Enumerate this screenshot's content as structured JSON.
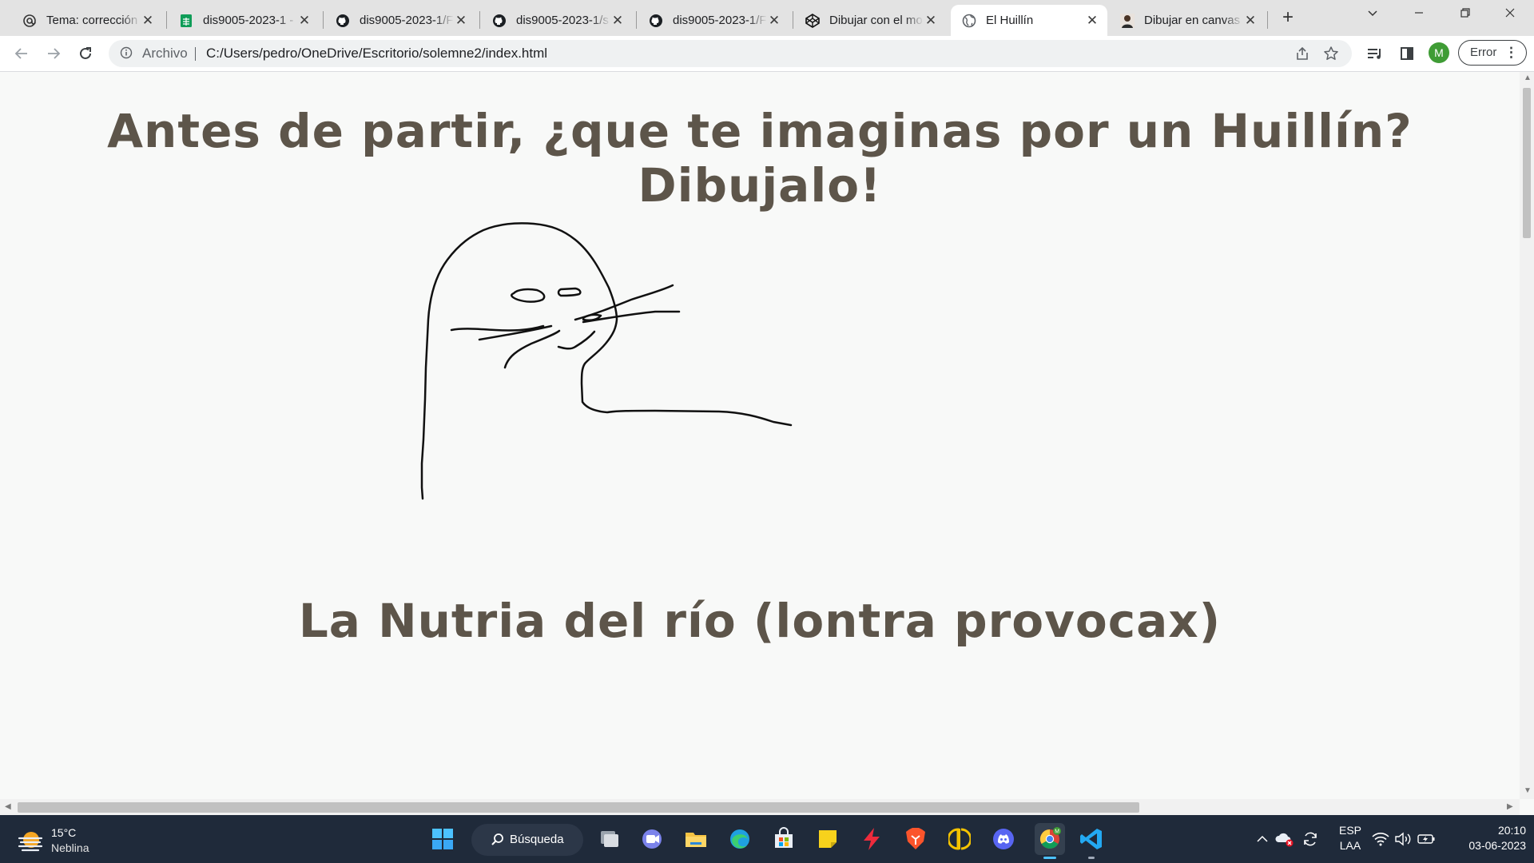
{
  "browser": {
    "tabs": [
      {
        "title": "Tema: corrección",
        "icon": "at-sign-icon"
      },
      {
        "title": "dis9005-2023-1 -",
        "icon": "sheets-icon"
      },
      {
        "title": "dis9005-2023-1/F",
        "icon": "github-icon"
      },
      {
        "title": "dis9005-2023-1/s",
        "icon": "github-icon"
      },
      {
        "title": "dis9005-2023-1/F",
        "icon": "github-icon"
      },
      {
        "title": "Dibujar con el mo",
        "icon": "codepen-icon"
      },
      {
        "title": "El Huillín",
        "icon": "globe-icon",
        "active": true
      },
      {
        "title": "Dibujar en canvas",
        "icon": "avatar-icon"
      }
    ],
    "address_bar": {
      "scheme_label": "Archivo",
      "url": "C:/Users/pedro/OneDrive/Escritorio/solemne2/index.html"
    },
    "profile_initial": "M",
    "error_button_label": "Error"
  },
  "page": {
    "heading": "Antes de partir, ¿que te imaginas por un Huillín? Dibujalo!",
    "section_heading": "La Nutria del río (lontra provocax)",
    "heading_color": "#5d554a",
    "background_color": "#f8f9f8"
  },
  "taskbar": {
    "weather": {
      "temp": "15°C",
      "condition": "Neblina"
    },
    "search_label": "Búsqueda",
    "language": {
      "line1": "ESP",
      "line2": "LAA"
    },
    "clock": {
      "time": "20:10",
      "date": "03-06-2023"
    },
    "pinned_apps": [
      "start-icon",
      "search-icon",
      "task-view-icon",
      "teams-icon",
      "file-explorer-icon",
      "edge-icon",
      "store-icon",
      "sticky-notes-icon",
      "lightning-icon",
      "brave-icon",
      "wacom-icon",
      "discord-icon",
      "chrome-icon",
      "vscode-icon"
    ]
  }
}
